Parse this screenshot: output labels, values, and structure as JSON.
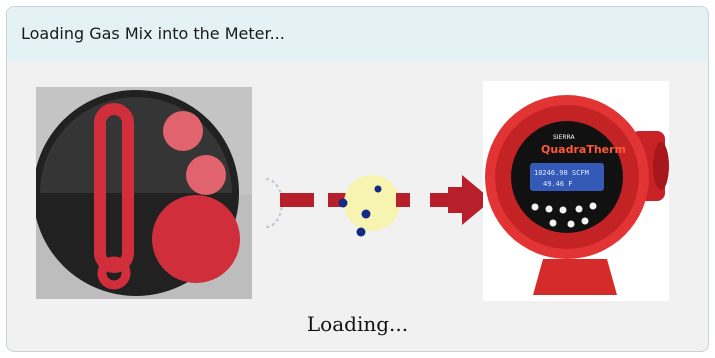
{
  "window": {
    "title": "Loading Gas Mix into the Meter..."
  },
  "meter": {
    "brand": "SIERRA",
    "model": "QuadraTherm",
    "display_line1": "10246.90 SCFM",
    "display_line2": "49.46 F"
  },
  "status": {
    "loading_text": "Loading..."
  },
  "icons": {
    "logo": "sierra-logo-icon",
    "flow": "gas-flow-animation-icon",
    "arrow": "arrow-right-icon"
  },
  "colors": {
    "accent_red": "#d4262d",
    "title_bar": "#e4f2f5"
  }
}
